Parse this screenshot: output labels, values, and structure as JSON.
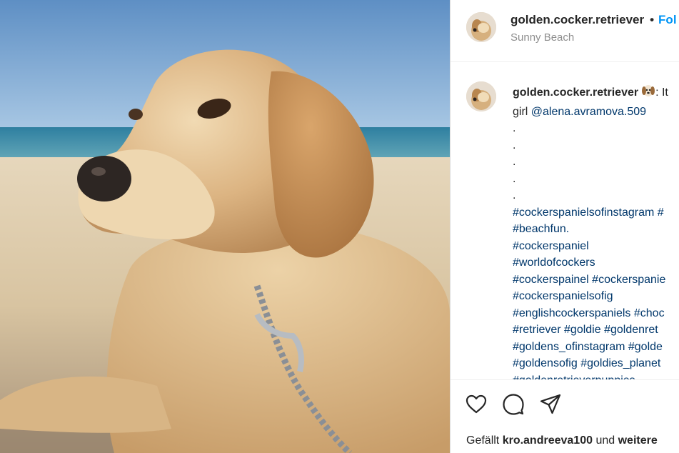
{
  "post": {
    "username": "golden.cocker.retriever",
    "follow_label": "Fol",
    "location": "Sunny Beach"
  },
  "caption": {
    "username": "golden.cocker.retriever",
    "text_start": ": It",
    "line2_prefix": "girl ",
    "mention": "@alena.avramova.509",
    "dots": [
      ".",
      ".",
      ".",
      ".",
      "."
    ],
    "hashtag_lines": [
      "#cockerspanielsofinstagram #",
      "#beachfun.",
      "#cockerspaniel",
      "#worldofcockers",
      "#cockerspainel #cockerspanie",
      "#cockerspanielsofig",
      "#englishcockerspaniels #choc",
      "#retriever #goldie #goldenret",
      "#goldens_ofinstagram #golde",
      "#goldensofig #goldies_planet",
      "#goldenretrieverpuppies"
    ]
  },
  "actions": {
    "like_icon": "heart-icon",
    "comment_icon": "comment-icon",
    "share_icon": "send-icon"
  },
  "likes": {
    "prefix": "Gefällt ",
    "user": "kro.andreeva100",
    "middle": " und ",
    "suffix": "weitere"
  },
  "colors": {
    "link": "#00376b",
    "follow": "#0095f6",
    "muted": "#8e8e8e"
  }
}
